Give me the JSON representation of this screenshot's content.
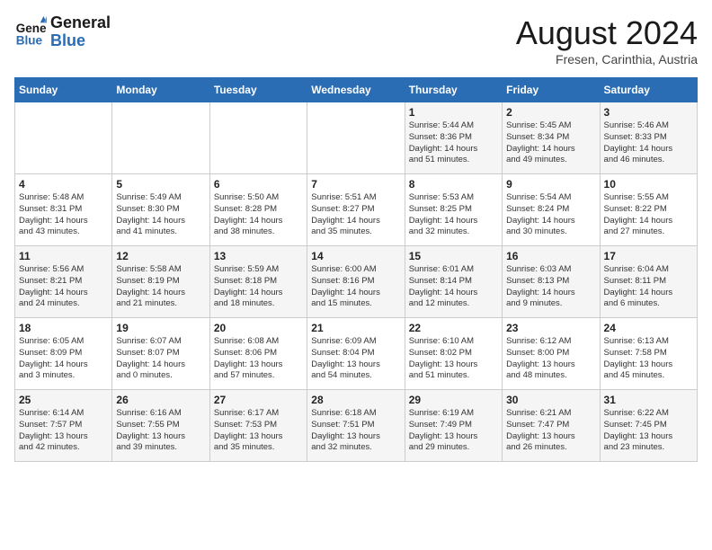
{
  "logo": {
    "line1": "General",
    "line2": "Blue"
  },
  "header": {
    "month_year": "August 2024",
    "location": "Fresen, Carinthia, Austria"
  },
  "days_of_week": [
    "Sunday",
    "Monday",
    "Tuesday",
    "Wednesday",
    "Thursday",
    "Friday",
    "Saturday"
  ],
  "weeks": [
    [
      {
        "day": "",
        "info": ""
      },
      {
        "day": "",
        "info": ""
      },
      {
        "day": "",
        "info": ""
      },
      {
        "day": "",
        "info": ""
      },
      {
        "day": "1",
        "info": "Sunrise: 5:44 AM\nSunset: 8:36 PM\nDaylight: 14 hours\nand 51 minutes."
      },
      {
        "day": "2",
        "info": "Sunrise: 5:45 AM\nSunset: 8:34 PM\nDaylight: 14 hours\nand 49 minutes."
      },
      {
        "day": "3",
        "info": "Sunrise: 5:46 AM\nSunset: 8:33 PM\nDaylight: 14 hours\nand 46 minutes."
      }
    ],
    [
      {
        "day": "4",
        "info": "Sunrise: 5:48 AM\nSunset: 8:31 PM\nDaylight: 14 hours\nand 43 minutes."
      },
      {
        "day": "5",
        "info": "Sunrise: 5:49 AM\nSunset: 8:30 PM\nDaylight: 14 hours\nand 41 minutes."
      },
      {
        "day": "6",
        "info": "Sunrise: 5:50 AM\nSunset: 8:28 PM\nDaylight: 14 hours\nand 38 minutes."
      },
      {
        "day": "7",
        "info": "Sunrise: 5:51 AM\nSunset: 8:27 PM\nDaylight: 14 hours\nand 35 minutes."
      },
      {
        "day": "8",
        "info": "Sunrise: 5:53 AM\nSunset: 8:25 PM\nDaylight: 14 hours\nand 32 minutes."
      },
      {
        "day": "9",
        "info": "Sunrise: 5:54 AM\nSunset: 8:24 PM\nDaylight: 14 hours\nand 30 minutes."
      },
      {
        "day": "10",
        "info": "Sunrise: 5:55 AM\nSunset: 8:22 PM\nDaylight: 14 hours\nand 27 minutes."
      }
    ],
    [
      {
        "day": "11",
        "info": "Sunrise: 5:56 AM\nSunset: 8:21 PM\nDaylight: 14 hours\nand 24 minutes."
      },
      {
        "day": "12",
        "info": "Sunrise: 5:58 AM\nSunset: 8:19 PM\nDaylight: 14 hours\nand 21 minutes."
      },
      {
        "day": "13",
        "info": "Sunrise: 5:59 AM\nSunset: 8:18 PM\nDaylight: 14 hours\nand 18 minutes."
      },
      {
        "day": "14",
        "info": "Sunrise: 6:00 AM\nSunset: 8:16 PM\nDaylight: 14 hours\nand 15 minutes."
      },
      {
        "day": "15",
        "info": "Sunrise: 6:01 AM\nSunset: 8:14 PM\nDaylight: 14 hours\nand 12 minutes."
      },
      {
        "day": "16",
        "info": "Sunrise: 6:03 AM\nSunset: 8:13 PM\nDaylight: 14 hours\nand 9 minutes."
      },
      {
        "day": "17",
        "info": "Sunrise: 6:04 AM\nSunset: 8:11 PM\nDaylight: 14 hours\nand 6 minutes."
      }
    ],
    [
      {
        "day": "18",
        "info": "Sunrise: 6:05 AM\nSunset: 8:09 PM\nDaylight: 14 hours\nand 3 minutes."
      },
      {
        "day": "19",
        "info": "Sunrise: 6:07 AM\nSunset: 8:07 PM\nDaylight: 14 hours\nand 0 minutes."
      },
      {
        "day": "20",
        "info": "Sunrise: 6:08 AM\nSunset: 8:06 PM\nDaylight: 13 hours\nand 57 minutes."
      },
      {
        "day": "21",
        "info": "Sunrise: 6:09 AM\nSunset: 8:04 PM\nDaylight: 13 hours\nand 54 minutes."
      },
      {
        "day": "22",
        "info": "Sunrise: 6:10 AM\nSunset: 8:02 PM\nDaylight: 13 hours\nand 51 minutes."
      },
      {
        "day": "23",
        "info": "Sunrise: 6:12 AM\nSunset: 8:00 PM\nDaylight: 13 hours\nand 48 minutes."
      },
      {
        "day": "24",
        "info": "Sunrise: 6:13 AM\nSunset: 7:58 PM\nDaylight: 13 hours\nand 45 minutes."
      }
    ],
    [
      {
        "day": "25",
        "info": "Sunrise: 6:14 AM\nSunset: 7:57 PM\nDaylight: 13 hours\nand 42 minutes."
      },
      {
        "day": "26",
        "info": "Sunrise: 6:16 AM\nSunset: 7:55 PM\nDaylight: 13 hours\nand 39 minutes."
      },
      {
        "day": "27",
        "info": "Sunrise: 6:17 AM\nSunset: 7:53 PM\nDaylight: 13 hours\nand 35 minutes."
      },
      {
        "day": "28",
        "info": "Sunrise: 6:18 AM\nSunset: 7:51 PM\nDaylight: 13 hours\nand 32 minutes."
      },
      {
        "day": "29",
        "info": "Sunrise: 6:19 AM\nSunset: 7:49 PM\nDaylight: 13 hours\nand 29 minutes."
      },
      {
        "day": "30",
        "info": "Sunrise: 6:21 AM\nSunset: 7:47 PM\nDaylight: 13 hours\nand 26 minutes."
      },
      {
        "day": "31",
        "info": "Sunrise: 6:22 AM\nSunset: 7:45 PM\nDaylight: 13 hours\nand 23 minutes."
      }
    ]
  ]
}
